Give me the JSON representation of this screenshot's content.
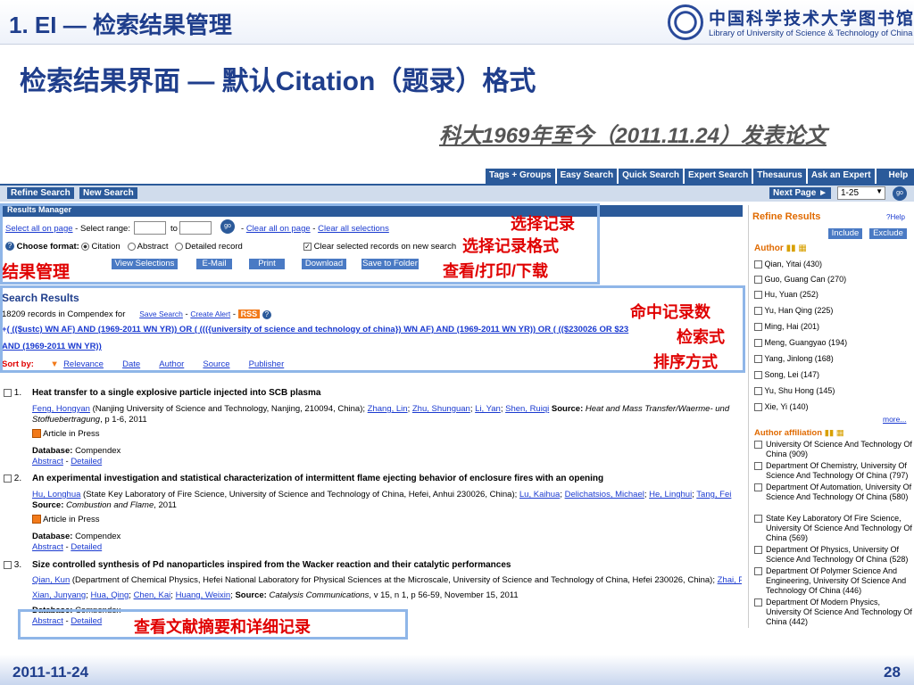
{
  "slide": {
    "title": "1. EI — 检索结果管理",
    "subtitle": "检索结果界面 — 默认Citation（题录）格式",
    "note": "科大1969年至今（2011.11.24）发表论文",
    "date": "2011-11-24",
    "page": "28"
  },
  "logo": {
    "cn": "中国科学技术大学图书馆",
    "en": "Library of University of Science & Technology of China"
  },
  "tabs": [
    "Tags + Groups",
    "Easy Search",
    "Quick Search",
    "Expert Search",
    "Thesaurus",
    "Ask an Expert",
    "Help"
  ],
  "appbar": {
    "refine": "Refine Search",
    "new": "New Search",
    "next": "Next Page ►",
    "range": "1-25"
  },
  "manager": {
    "head": "Results Manager",
    "select_all": "Select all on page",
    "dash": "-",
    "range_label": "Select range:",
    "to": "to",
    "go": "go",
    "clear_all": "Clear all on page",
    "clear_sel": "Clear all selections",
    "choose_format": "Choose format:",
    "fmt_citation": "Citation",
    "fmt_abstract": "Abstract",
    "fmt_detailed": "Detailed record",
    "clear_new": "Clear selected records on new search",
    "buttons": [
      "View Selections",
      "E-Mail",
      "Print",
      "Download",
      "Save to Folder"
    ]
  },
  "annotations": {
    "a1": "选择记录",
    "a2": "选择记录格式",
    "a3": "查看/打印/下载",
    "a4": "结果管理",
    "a5": "命中记录数",
    "a6": "检索式",
    "a7": "排序方式",
    "a8": "查看文献摘要和详细记录"
  },
  "search": {
    "head": "Search Results",
    "count": "18209 records in Compendex for",
    "save": "Save Search",
    "alert": "Create Alert",
    "rss": "RSS",
    "query1": "( (($ustc) WN AF) AND (1969-2011 WN YR)) OR ( ((({university of science and technology of china}) WN AF) AND (1969-2011 WN YR)) OR ( (($230026 OR $23",
    "query2": "AND (1969-2011 WN YR))",
    "sortby": "Sort by:",
    "sorts": [
      "Relevance",
      "Date",
      "Author",
      "Source",
      "Publisher"
    ]
  },
  "records": [
    {
      "num": "1.",
      "title": "Heat transfer to a single explosive particle injected into SCB plasma",
      "author_main": "Feng, Hongyan",
      "author_rest": " (Nanjing University of Science and Technology, Nanjing, 210094, China); ",
      "coauthors": [
        "Zhang, Lin",
        "Zhu, Shunguan",
        "Li, Yan",
        "Shen, Ruiqi"
      ],
      "source_label": "Source:",
      "source": "Heat and Mass Transfer/Waerme- und",
      "source2": "Stoffuebertragung",
      "source2_rest": ", p 1-6, 2011",
      "press": "Article in Press",
      "db_label": "Database:",
      "db": "Compendex",
      "abstract": "Abstract",
      "detailed": "Detailed"
    },
    {
      "num": "2.",
      "title": "An experimental investigation and statistical characterization of intermittent flame ejecting behavior of enclosure fires with an opening",
      "author_main": "Hu, Longhua",
      "author_rest": " (State Key Laboratory of Fire Science, University of Science and Technology of China, Hefei, Anhui 230026, China); ",
      "coauthors": [
        "Lu, Kaihua",
        "Delichatsios, Michael",
        "He, Linghui",
        "Tang, Fei"
      ],
      "source_label": "Source:",
      "source": "Combustion and Flame",
      "source_rest": ", 2011",
      "press": "Article in Press",
      "db_label": "Database:",
      "db": "Compendex",
      "abstract": "Abstract",
      "detailed": "Detailed"
    },
    {
      "num": "3.",
      "title": "Size controlled synthesis of Pd nanoparticles inspired from the Wacker reaction and their catalytic performances",
      "author_main": "Qian, Kun",
      "author_rest": " (Department of Chemical Physics, Hefei National Laboratory for Physical Sciences at the Microscale, University of Science and Technology of China, Hefei 230026, China); ",
      "coauthors": [
        "Zhai, Peng",
        "Xian, Junyang",
        "Hua, Qing",
        "Chen, Kai",
        "Huang, Weixin"
      ],
      "source_label": "Source:",
      "source": "Catalysis Communications",
      "source_rest": ", v 15, n 1, p 56-59, November 15, 2011",
      "db_label": "Database:",
      "db": "Compendex",
      "abstract": "Abstract",
      "detailed": "Detailed"
    }
  ],
  "refine": {
    "head": "Refine Results",
    "help": "?Help",
    "include": "Include",
    "exclude": "Exclude",
    "author_head": "Author",
    "authors": [
      "Qian, Yitai (430)",
      "Guo, Guang Can (270)",
      "Hu, Yuan (252)",
      "Yu, Han Qing (225)",
      "Ming, Hai (201)",
      "Meng, Guangyao (194)",
      "Yang, Jinlong (168)",
      "Song, Lei (147)",
      "Yu, Shu Hong (145)",
      "Xie, Yi (140)"
    ],
    "more": "more...",
    "affil_head": "Author affiliation",
    "affils": [
      "University Of Science And Technology Of China (909)",
      "Department Of Chemistry, University Of Science And Technology Of China (797)",
      "Department Of Automation, University Of Science And Technology Of China (580)",
      "State Key Laboratory Of Fire Science, University Of Science And Technology Of China (569)",
      "Department Of Physics, University Of Science And Technology Of China (528)",
      "Department Of Polymer Science And Engineering, University Of Science And Technology Of China (446)",
      "Department Of Modern Physics, University Of Science And Technology Of China (442)"
    ]
  },
  "colors": {
    "title_blue": "#1f3e8c",
    "ei_blue": "#2b5a9a",
    "annot_red": "#e00000",
    "box_blue": "#8fb6e8"
  }
}
